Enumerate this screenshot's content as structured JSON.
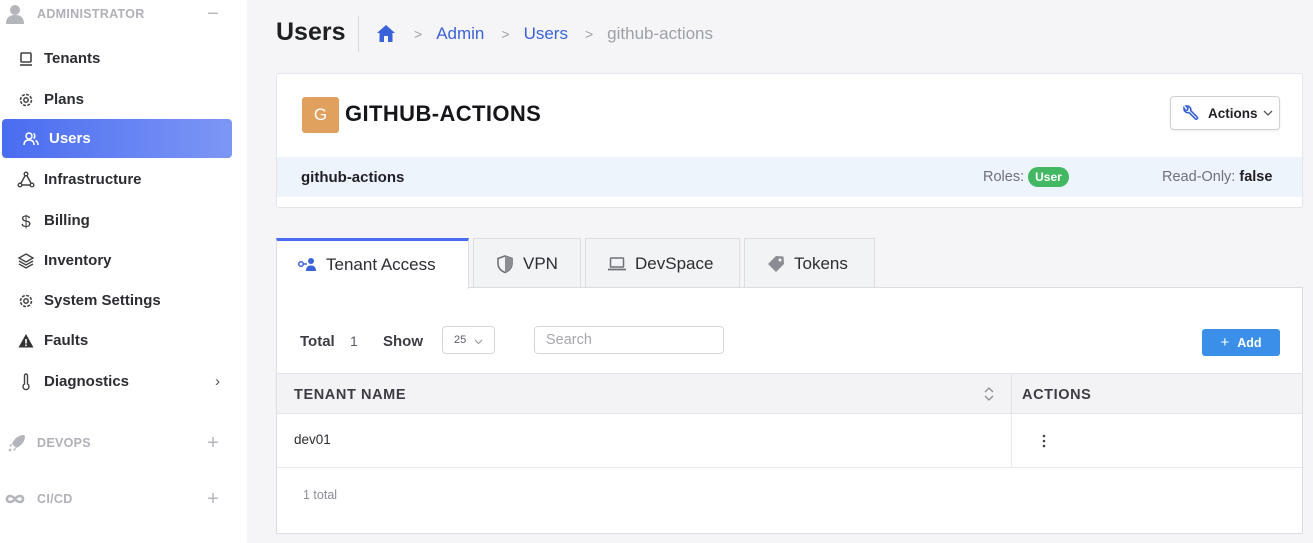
{
  "sidebar": {
    "administrator": {
      "label": "ADMINISTRATOR",
      "icon": "user-circle-icon",
      "toggle": "−"
    },
    "items": [
      {
        "label": "Tenants",
        "icon": "monitor-icon"
      },
      {
        "label": "Plans",
        "icon": "gear-icon"
      },
      {
        "label": "Users",
        "icon": "users-icon",
        "active": true
      },
      {
        "label": "Infrastructure",
        "icon": "network-icon"
      },
      {
        "label": "Billing",
        "icon": "dollar-icon"
      },
      {
        "label": "Inventory",
        "icon": "layers-icon"
      },
      {
        "label": "System Settings",
        "icon": "gear-icon"
      },
      {
        "label": "Faults",
        "icon": "warning-icon"
      },
      {
        "label": "Diagnostics",
        "icon": "thermometer-icon",
        "expandable": true
      }
    ],
    "devops": {
      "label": "DEVOPS",
      "icon": "rocket-icon",
      "toggle": "+"
    },
    "cicd": {
      "label": "CI/CD",
      "icon": "infinity-icon",
      "toggle": "+"
    }
  },
  "header": {
    "title": "Users",
    "breadcrumb": [
      "Admin",
      "Users",
      "github-actions"
    ]
  },
  "user": {
    "initial": "G",
    "display_name": "GITHUB-ACTIONS",
    "username": "github-actions",
    "roles_label": "Roles:",
    "role": "User",
    "readonly_label": "Read-Only:",
    "readonly_value": "false",
    "actions_label": "Actions"
  },
  "tabs": [
    {
      "label": "Tenant Access",
      "icon": "tenant-access-icon",
      "active": true
    },
    {
      "label": "VPN",
      "icon": "shield-icon"
    },
    {
      "label": "DevSpace",
      "icon": "laptop-icon"
    },
    {
      "label": "Tokens",
      "icon": "tag-icon"
    }
  ],
  "table": {
    "total_label": "Total",
    "total_value": "1",
    "show_label": "Show",
    "page_size": "25",
    "search_placeholder": "Search",
    "add_label": "Add",
    "columns": [
      "TENANT NAME",
      "ACTIONS"
    ],
    "rows": [
      {
        "tenant_name": "dev01"
      }
    ],
    "footer": "1 total"
  },
  "colors": {
    "accent": "#4a6cf0",
    "add_button": "#3b8fe8",
    "role_badge": "#42b862",
    "avatar": "#e0a15e"
  }
}
